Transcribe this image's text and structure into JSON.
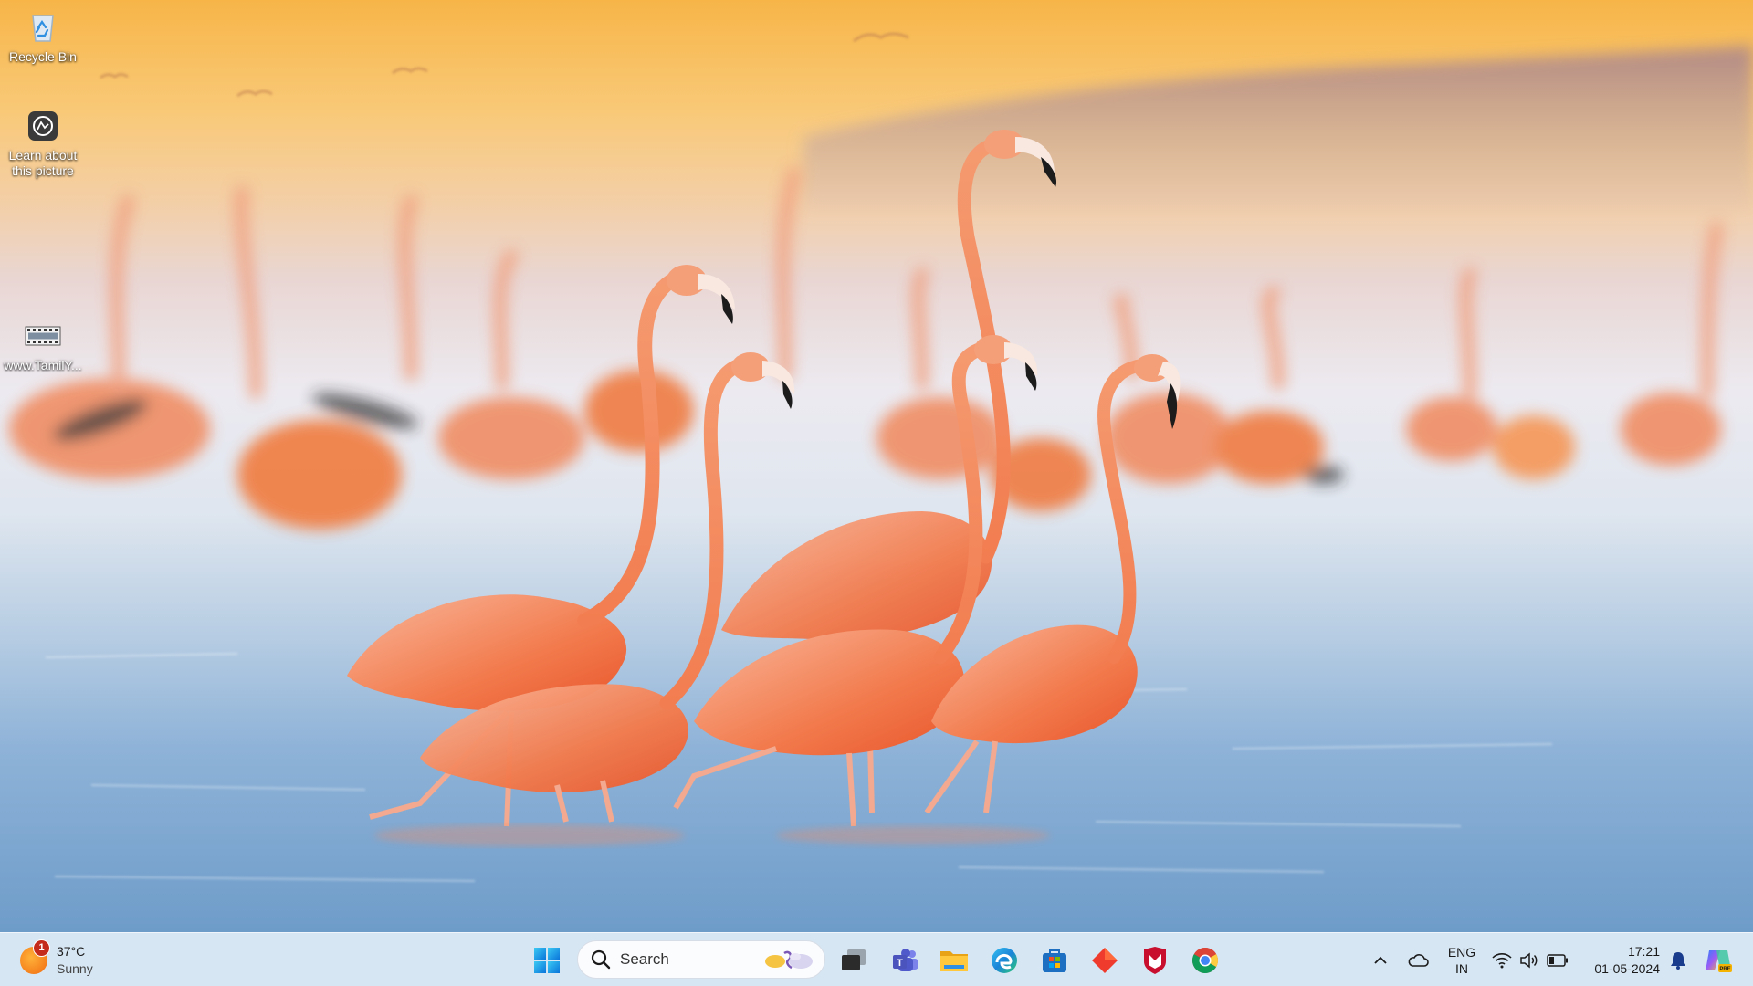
{
  "desktop": {
    "icons": [
      {
        "label": "Recycle Bin",
        "icon": "recycle-bin-icon"
      },
      {
        "label": "Learn about this picture",
        "icon": "camera-info-icon"
      },
      {
        "label": "www.TamilY...",
        "icon": "video-file-icon"
      }
    ]
  },
  "taskbar": {
    "weather": {
      "temperature": "37°C",
      "condition": "Sunny",
      "badge": "1"
    },
    "search": {
      "placeholder": "Search"
    },
    "apps": [
      {
        "name": "Start",
        "icon": "windows-start-icon"
      },
      {
        "name": "Task View",
        "icon": "task-view-icon"
      },
      {
        "name": "Microsoft Teams",
        "icon": "teams-icon"
      },
      {
        "name": "File Explorer",
        "icon": "file-explorer-icon"
      },
      {
        "name": "Microsoft Edge",
        "icon": "edge-icon"
      },
      {
        "name": "Microsoft Store",
        "icon": "store-icon"
      },
      {
        "name": "AnyDesk",
        "icon": "red-diamond-app-icon"
      },
      {
        "name": "McAfee",
        "icon": "mcafee-icon"
      },
      {
        "name": "Google Chrome",
        "icon": "chrome-icon"
      }
    ],
    "tray": {
      "language_line1": "ENG",
      "language_line2": "IN",
      "time": "17:21",
      "date": "01-05-2024"
    }
  },
  "colors": {
    "taskbar_bg": "#dce9f5",
    "sky_top": "#f7c25a",
    "water": "#7fa9d3",
    "flamingo": "#f2845a"
  }
}
